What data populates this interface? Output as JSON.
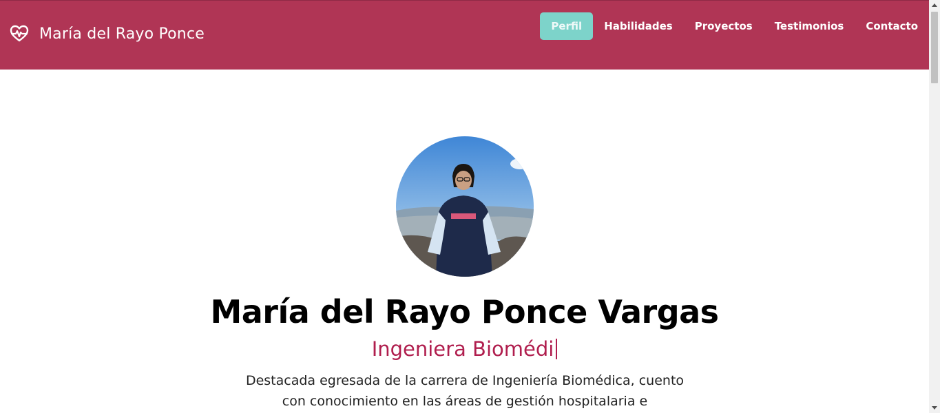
{
  "brand": {
    "name": "María del Rayo Ponce",
    "icon": "heart-pulse-icon"
  },
  "nav": {
    "items": [
      {
        "label": "Perfil",
        "active": true
      },
      {
        "label": "Habilidades",
        "active": false
      },
      {
        "label": "Proyectos",
        "active": false
      },
      {
        "label": "Testimonios",
        "active": false
      },
      {
        "label": "Contacto",
        "active": false
      }
    ]
  },
  "hero": {
    "name": "María del Rayo Ponce Vargas",
    "role_typed": "Ingeniera Biomédi",
    "description": "Destacada egresada de la carrera de Ingeniería Biomédica, cuento con conocimiento en las áreas de gestión hospitalaria e"
  },
  "colors": {
    "navbar": "#b03555",
    "active_nav": "#7dd3ca",
    "accent_text": "#b01e4e"
  }
}
